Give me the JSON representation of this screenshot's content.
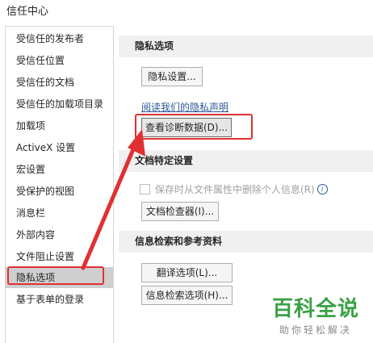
{
  "window": {
    "title": "信任中心"
  },
  "sidebar": {
    "items": [
      {
        "label": "受信任的发布者"
      },
      {
        "label": "受信任位置"
      },
      {
        "label": "受信任的文档"
      },
      {
        "label": "受信任的加载项目录"
      },
      {
        "label": "加载项"
      },
      {
        "label": "ActiveX 设置"
      },
      {
        "label": "宏设置"
      },
      {
        "label": "受保护的视图"
      },
      {
        "label": "消息栏"
      },
      {
        "label": "外部内容"
      },
      {
        "label": "文件阻止设置"
      },
      {
        "label": "隐私选项"
      },
      {
        "label": "基于表单的登录"
      }
    ],
    "selected": "隐私选项"
  },
  "privacy": {
    "header": "隐私选项",
    "settings_button": "隐私设置...",
    "statement_link": "阅读我们的隐私声明",
    "diagnostics_button": "查看诊断数据(D)..."
  },
  "document_specific": {
    "header": "文档特定设置",
    "remove_personal_info_label": "保存时从文件属性中删除个人信息(R)",
    "remove_personal_info_checked": false,
    "remove_personal_info_enabled": false,
    "inspector_button": "文档检查器(I)..."
  },
  "research": {
    "header": "信息检索和参考资料",
    "translation_button": "翻译选项(L)...",
    "research_button": "信息检索选项(H)..."
  },
  "annotation": {
    "color": "#e03131"
  },
  "watermark": {
    "title": "百科全说",
    "subtitle": "助你轻松解决",
    "color": "#3aa146"
  }
}
